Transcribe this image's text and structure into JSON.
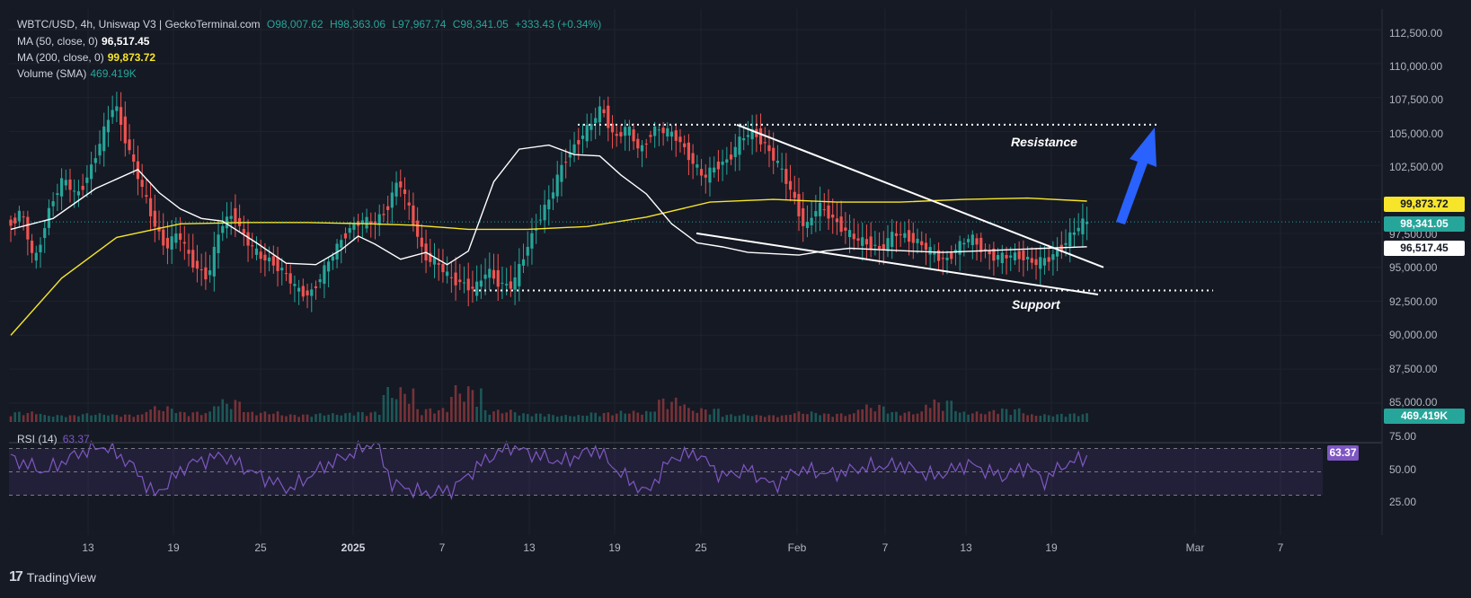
{
  "header": {
    "symbol": "WBTC/USD, 4h, Uniswap V3 | GeckoTerminal.com",
    "open": "O98,007.62",
    "high": "H98,363.06",
    "low": "L97,967.74",
    "close": "C98,341.05",
    "change": "+333.43 (+0.34%)"
  },
  "legend": [
    {
      "label": "MA (50, close, 0)",
      "value": "96,517.45",
      "color": "#ffffff"
    },
    {
      "label": "MA (200, close, 0)",
      "value": "99,873.72",
      "color": "#f7e52a"
    },
    {
      "label": "Volume (SMA)",
      "value": "469.419K",
      "color": "#26a69a"
    }
  ],
  "rsi": {
    "label": "RSI (14)",
    "value": "63.37",
    "color": "#7e57c2",
    "ticks": [
      "75.00",
      "50.00",
      "25.00"
    ]
  },
  "price_axis": {
    "ticks": [
      "112,500.00",
      "110,000.00",
      "107,500.00",
      "105,000.00",
      "102,500.00",
      "97,500.00",
      "95,000.00",
      "92,500.00",
      "90,000.00",
      "87,500.00",
      "85,000.00"
    ]
  },
  "badges": {
    "ma200": {
      "text": "99,873.72",
      "bg": "#f7e52a",
      "fg": "#131722"
    },
    "price": {
      "text": "98,341.05",
      "bg": "#26a69a",
      "fg": "#ffffff"
    },
    "ma50": {
      "text": "96,517.45",
      "bg": "#ffffff",
      "fg": "#131722"
    },
    "volume": {
      "text": "469.419K",
      "bg": "#26a69a",
      "fg": "#ffffff"
    },
    "rsi": {
      "text": "63.37",
      "bg": "#7e57c2",
      "fg": "#ffffff"
    }
  },
  "time_axis": {
    "ticks": [
      "13",
      "19",
      "25",
      "2025",
      "7",
      "13",
      "19",
      "25",
      "Feb",
      "7",
      "13",
      "19",
      "Mar",
      "7"
    ]
  },
  "annotations": {
    "resistance": "Resistance",
    "support": "Support"
  },
  "footer": {
    "brand": "TradingView",
    "logo": "17"
  },
  "colors": {
    "up": "#26a69a",
    "down": "#ef5350",
    "ma50": "#ffffff",
    "ma200": "#f7e52a",
    "arrow": "#2962ff"
  },
  "chart_data": {
    "type": "candlestick",
    "timeframe": "4h",
    "ylim": [
      85000,
      113500
    ],
    "price_path": [
      [
        0,
        98000
      ],
      [
        3,
        99200
      ],
      [
        6,
        95200
      ],
      [
        10,
        99800
      ],
      [
        13,
        101500
      ],
      [
        16,
        100200
      ],
      [
        19,
        102000
      ],
      [
        22,
        104500
      ],
      [
        25,
        107200
      ],
      [
        28,
        104000
      ],
      [
        31,
        101200
      ],
      [
        34,
        98500
      ],
      [
        37,
        96500
      ],
      [
        40,
        97500
      ],
      [
        43,
        95500
      ],
      [
        47,
        94200
      ],
      [
        50,
        98000
      ],
      [
        53,
        99000
      ],
      [
        56,
        97000
      ],
      [
        59,
        95800
      ],
      [
        62,
        95500
      ],
      [
        65,
        94600
      ],
      [
        68,
        93300
      ],
      [
        71,
        93000
      ],
      [
        74,
        94500
      ],
      [
        77,
        96200
      ],
      [
        80,
        97800
      ],
      [
        83,
        98400
      ],
      [
        86,
        98200
      ],
      [
        89,
        99200
      ],
      [
        92,
        101500
      ],
      [
        95,
        98800
      ],
      [
        98,
        95900
      ],
      [
        101,
        95300
      ],
      [
        104,
        94200
      ],
      [
        107,
        93900
      ],
      [
        110,
        93300
      ],
      [
        113,
        94800
      ],
      [
        116,
        93800
      ],
      [
        119,
        93600
      ],
      [
        122,
        96200
      ],
      [
        125,
        98500
      ],
      [
        128,
        100200
      ],
      [
        131,
        102800
      ],
      [
        134,
        104200
      ],
      [
        137,
        105300
      ],
      [
        140,
        106800
      ],
      [
        143,
        104500
      ],
      [
        146,
        105300
      ],
      [
        149,
        103500
      ],
      [
        152,
        105200
      ],
      [
        155,
        105000
      ],
      [
        158,
        104500
      ],
      [
        161,
        103000
      ],
      [
        164,
        101500
      ],
      [
        167,
        102500
      ],
      [
        170,
        103000
      ],
      [
        173,
        104500
      ],
      [
        176,
        105000
      ],
      [
        179,
        103800
      ],
      [
        182,
        102300
      ],
      [
        185,
        100400
      ],
      [
        188,
        97800
      ],
      [
        191,
        99500
      ],
      [
        194,
        98800
      ],
      [
        197,
        97800
      ],
      [
        200,
        97000
      ],
      [
        203,
        96800
      ],
      [
        206,
        96300
      ],
      [
        209,
        97500
      ],
      [
        212,
        97300
      ],
      [
        215,
        96800
      ],
      [
        218,
        96000
      ],
      [
        221,
        95500
      ],
      [
        224,
        96500
      ],
      [
        227,
        97200
      ],
      [
        230,
        96300
      ],
      [
        233,
        95700
      ],
      [
        236,
        95800
      ],
      [
        239,
        95900
      ],
      [
        242,
        95300
      ],
      [
        245,
        95500
      ],
      [
        248,
        96300
      ],
      [
        251,
        97500
      ],
      [
        254,
        98341
      ]
    ],
    "ma50": [
      [
        0,
        97800
      ],
      [
        10,
        98600
      ],
      [
        20,
        100800
      ],
      [
        30,
        102200
      ],
      [
        35,
        100500
      ],
      [
        40,
        99300
      ],
      [
        45,
        98600
      ],
      [
        50,
        98400
      ],
      [
        58,
        96800
      ],
      [
        65,
        95300
      ],
      [
        72,
        95200
      ],
      [
        78,
        96300
      ],
      [
        82,
        97300
      ],
      [
        86,
        96700
      ],
      [
        92,
        95600
      ],
      [
        98,
        96100
      ],
      [
        103,
        95200
      ],
      [
        108,
        96200
      ],
      [
        114,
        101300
      ],
      [
        120,
        103700
      ],
      [
        127,
        104000
      ],
      [
        133,
        103300
      ],
      [
        139,
        103200
      ],
      [
        144,
        101800
      ],
      [
        150,
        100400
      ],
      [
        156,
        98200
      ],
      [
        162,
        96800
      ],
      [
        168,
        96500
      ],
      [
        174,
        96100
      ],
      [
        180,
        96000
      ],
      [
        186,
        95900
      ],
      [
        192,
        96200
      ],
      [
        198,
        96400
      ],
      [
        205,
        96300
      ],
      [
        212,
        96200
      ],
      [
        220,
        96100
      ],
      [
        228,
        96200
      ],
      [
        236,
        96300
      ],
      [
        244,
        96400
      ],
      [
        254,
        96517
      ]
    ],
    "ma200": [
      [
        0,
        90000
      ],
      [
        12,
        94200
      ],
      [
        25,
        97200
      ],
      [
        40,
        98200
      ],
      [
        55,
        98300
      ],
      [
        70,
        98300
      ],
      [
        85,
        98200
      ],
      [
        95,
        98100
      ],
      [
        108,
        97800
      ],
      [
        122,
        97800
      ],
      [
        136,
        98000
      ],
      [
        150,
        98700
      ],
      [
        165,
        99800
      ],
      [
        180,
        100000
      ],
      [
        195,
        99800
      ],
      [
        210,
        99800
      ],
      [
        225,
        100000
      ],
      [
        240,
        100100
      ],
      [
        254,
        99874
      ]
    ],
    "volume_levels": [
      0.2,
      0.1,
      0.15,
      0.12,
      0.35,
      0.2,
      0.55,
      0.2,
      0.12,
      0.15,
      0.2,
      0.9,
      0.3,
      0.95,
      0.25,
      0.15,
      0.1,
      0.18,
      0.22,
      0.6,
      0.3,
      0.12,
      0.1,
      0.2,
      0.15,
      0.4,
      0.2,
      0.55,
      0.2,
      0.3,
      0.12,
      0.15
    ],
    "rsi_path": [
      [
        0,
        62
      ],
      [
        8,
        50
      ],
      [
        16,
        66
      ],
      [
        22,
        72
      ],
      [
        28,
        58
      ],
      [
        34,
        30
      ],
      [
        42,
        57
      ],
      [
        50,
        64
      ],
      [
        58,
        48
      ],
      [
        66,
        35
      ],
      [
        74,
        55
      ],
      [
        82,
        68
      ],
      [
        86,
        76
      ],
      [
        90,
        40
      ],
      [
        98,
        31
      ],
      [
        104,
        35
      ],
      [
        112,
        60
      ],
      [
        118,
        72
      ],
      [
        124,
        64
      ],
      [
        130,
        58
      ],
      [
        138,
        70
      ],
      [
        144,
        48
      ],
      [
        150,
        32
      ],
      [
        156,
        62
      ],
      [
        162,
        66
      ],
      [
        168,
        46
      ],
      [
        174,
        52
      ],
      [
        180,
        38
      ],
      [
        186,
        52
      ],
      [
        194,
        48
      ],
      [
        202,
        54
      ],
      [
        210,
        56
      ],
      [
        218,
        46
      ],
      [
        226,
        57
      ],
      [
        234,
        46
      ],
      [
        240,
        55
      ],
      [
        244,
        42
      ],
      [
        248,
        55
      ],
      [
        254,
        63
      ]
    ],
    "rsi_levels": [
      70,
      50,
      30
    ],
    "trendlines": {
      "resistance_upper": {
        "from": [
          "25",
          105500
        ],
        "to": [
          "after 19 Feb",
          95000
        ]
      },
      "support_lower": {
        "from": [
          "25",
          97500
        ],
        "to": [
          "after 19 Feb",
          93000
        ]
      },
      "resistance_level": 105500,
      "support_level": 93300
    }
  }
}
